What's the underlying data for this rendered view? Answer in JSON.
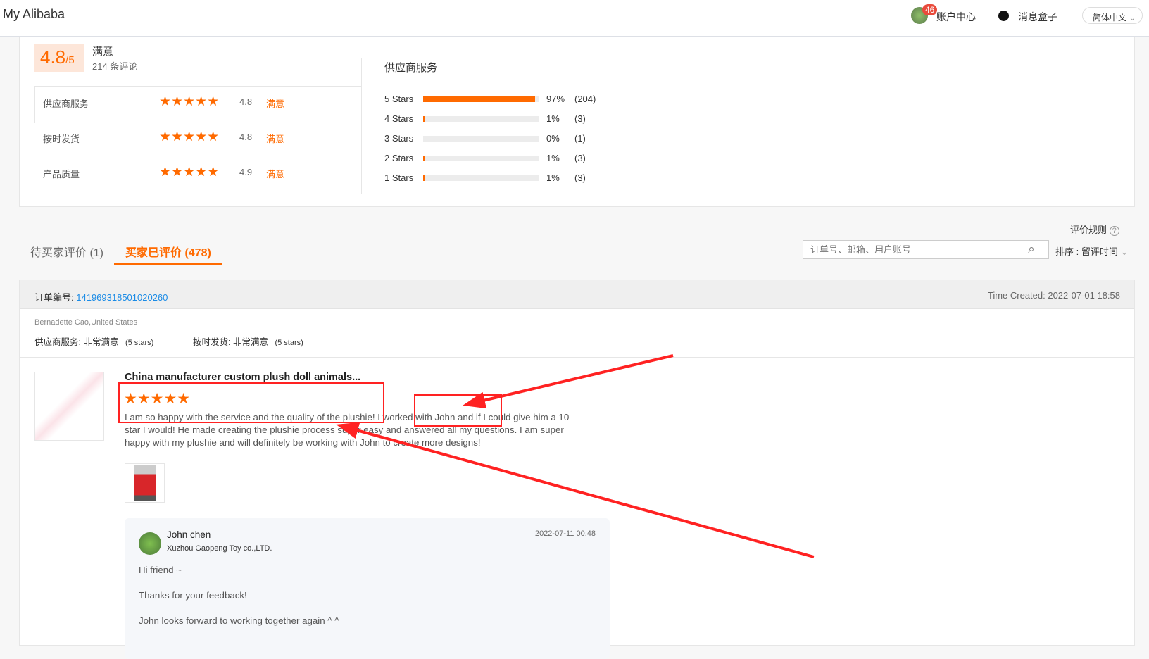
{
  "header": {
    "title": "My Alibaba",
    "notification_count": "46",
    "account_center": "账户中心",
    "message_box": "消息盒子",
    "language": "简体中文"
  },
  "summary": {
    "score": "4.8",
    "score_max": "/5",
    "level": "满意",
    "review_count": "214 条评论",
    "dimensions": [
      {
        "label": "供应商服务",
        "stars": 5,
        "score": "4.8",
        "level": "满意"
      },
      {
        "label": "按时发货",
        "stars": 5,
        "score": "4.8",
        "level": "满意"
      },
      {
        "label": "产品质量",
        "stars": 5,
        "score": "4.9",
        "level": "满意"
      }
    ]
  },
  "distribution": {
    "title": "供应商服务",
    "rows": [
      {
        "label": "5 Stars",
        "percent": 97,
        "percent_text": "97%",
        "count": "(204)"
      },
      {
        "label": "4 Stars",
        "percent": 1,
        "percent_text": "1%",
        "count": "(3)"
      },
      {
        "label": "3 Stars",
        "percent": 0,
        "percent_text": "0%",
        "count": "(1)"
      },
      {
        "label": "2 Stars",
        "percent": 1,
        "percent_text": "1%",
        "count": "(3)"
      },
      {
        "label": "1 Stars",
        "percent": 1,
        "percent_text": "1%",
        "count": "(3)"
      }
    ]
  },
  "tabs": [
    {
      "label": "待买家评价 (1)"
    },
    {
      "label": "买家已评价 (478)",
      "active": true
    }
  ],
  "rules_link": "评价规则",
  "search": {
    "placeholder": "订单号、邮箱、用户账号"
  },
  "sort": "排序 : 留评时间",
  "order": {
    "label": "订单编号:",
    "number": "141969318501020260",
    "time": "Time Created: 2022-07-01 18:58",
    "buyer": "Bernadette Cao,United States",
    "ratings": [
      {
        "label": "供应商服务:",
        "value": "非常满意",
        "stars": "(5 stars)"
      },
      {
        "label": "按时发货:",
        "value": "非常满意",
        "stars": "(5 stars)"
      }
    ],
    "product_title": "China manufacturer custom plush doll animals...",
    "review_stars": 5,
    "review_text": "I am so happy with the service and the quality of the plushie! I worked with John and if I could give him a 10 star I would! He made creating the plushie process super easy and answered all my questions. I am super happy with my plushie and will definitely be working with John to create more designs!",
    "reply": {
      "name": "John chen",
      "company": "Xuzhou Gaopeng Toy co.,LTD.",
      "date": "2022-07-11 00:48",
      "lines": [
        "Hi friend ~",
        "Thanks for your feedback!",
        "John looks forward to working together again ^ ^"
      ]
    }
  },
  "colors": {
    "accent": "#ff6a00",
    "link": "#1a8be6",
    "annotation": "#ff2222"
  }
}
